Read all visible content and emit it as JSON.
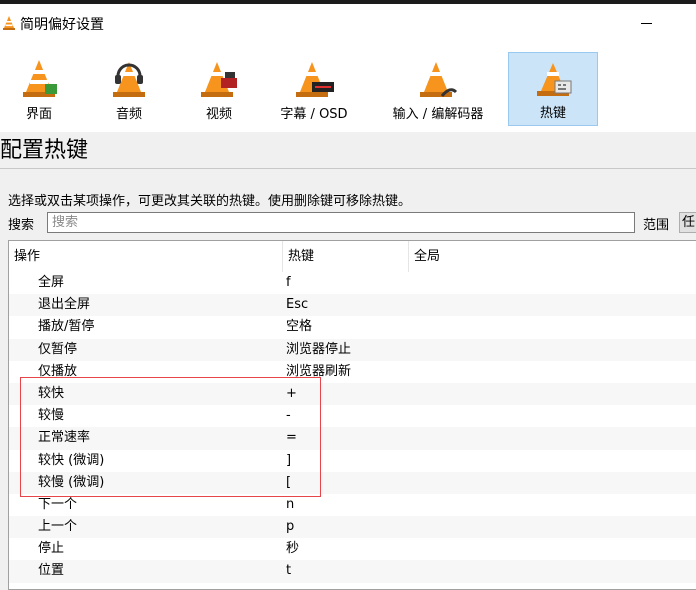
{
  "window": {
    "title": "简明偏好设置"
  },
  "categories": [
    {
      "label": "界面"
    },
    {
      "label": "音频"
    },
    {
      "label": "视频"
    },
    {
      "label": "字幕 / OSD"
    },
    {
      "label": "输入 / 编解码器"
    },
    {
      "label": "热键"
    }
  ],
  "selected_category": "热键",
  "section": {
    "title": "配置热键"
  },
  "instruction": "选择或双击某项操作，可更改其关联的热键。使用删除键可移除热键。",
  "search": {
    "label": "搜索",
    "placeholder": "搜索",
    "value": ""
  },
  "scope": {
    "label": "范围",
    "value": "任"
  },
  "table": {
    "headers": [
      "操作",
      "热键",
      "全局"
    ],
    "rows": [
      {
        "action": "全屏",
        "key": "f",
        "global": ""
      },
      {
        "action": "退出全屏",
        "key": "Esc",
        "global": ""
      },
      {
        "action": "播放/暂停",
        "key": "空格",
        "global": ""
      },
      {
        "action": "仅暂停",
        "key": "浏览器停止",
        "global": ""
      },
      {
        "action": "仅播放",
        "key": "浏览器刷新",
        "global": ""
      },
      {
        "action": "较快",
        "key": "+",
        "global": ""
      },
      {
        "action": "较慢",
        "key": "-",
        "global": ""
      },
      {
        "action": "正常速率",
        "key": "=",
        "global": ""
      },
      {
        "action": "较快 (微调)",
        "key": "]",
        "global": ""
      },
      {
        "action": "较慢 (微调)",
        "key": "[",
        "global": ""
      },
      {
        "action": "下一个",
        "key": "n",
        "global": ""
      },
      {
        "action": "上一个",
        "key": "p",
        "global": ""
      },
      {
        "action": "停止",
        "key": "秒",
        "global": ""
      },
      {
        "action": "位置",
        "key": "t",
        "global": ""
      }
    ]
  },
  "colors": {
    "accent": "#cce4f7",
    "cone": "#f7941d",
    "annotation": "#e8454a"
  }
}
